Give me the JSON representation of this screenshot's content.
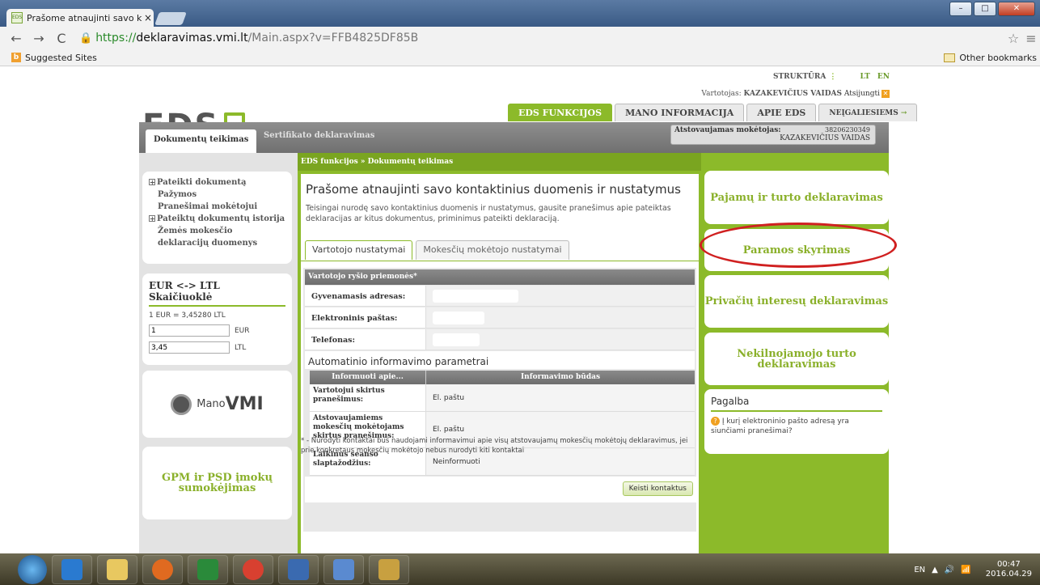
{
  "browser": {
    "tab_title": "Prašome atnaujinti savo k",
    "tab_close": "×",
    "url_https": "https://",
    "url_host": "deklaravimas.vmi.lt",
    "url_path": "/Main.aspx?v=FFB4825DF85B",
    "bookmark_suggested": "Suggested Sites",
    "bookmark_other": "Other bookmarks"
  },
  "header": {
    "logo_text": "EDS",
    "struktura": "STRUKTŪRA",
    "lang_lt": "LT",
    "lang_en": "EN",
    "user_label": "Vartotojas:",
    "user_name": "KAZAKEVIČIUS VAIDAS",
    "logout": "Atsijungti",
    "tabs": [
      "EDS FUNKCIJOS",
      "MANO INFORMACIJA",
      "APIE EDS",
      "NEĮGALIESIEMS"
    ]
  },
  "subnav": {
    "tab_active": "Dokumentų teikimas",
    "tab_other": "Sertifikato deklaravimas",
    "payer_label": "Atstovaujamas mokėtojas:",
    "payer_code": "38206230349",
    "payer_name": "KAZAKEVIČIUS VAIDAS"
  },
  "sidebar": {
    "items": [
      "Pateikti dokumentą",
      "Pažymos",
      "Pranešimai mokėtojui",
      "Pateiktų dokumentų istorija",
      "Žemės mokesčio deklaracijų duomenys"
    ],
    "calc_title": "EUR <-> LTL Skaičiuoklė",
    "calc_rate": "1 EUR = 3,45280 LTL",
    "calc_eur_value": "1",
    "calc_eur": "EUR",
    "calc_ltl_value": "3,45",
    "calc_ltl": "LTL",
    "mano_prefix": "Mano",
    "mano_vmi": "VMI",
    "gpm": "GPM ir PSD įmokų sumokėjimas"
  },
  "main": {
    "breadcrumb": "EDS funkcijos » Dokumentų teikimas",
    "title": "Prašome atnaujinti savo kontaktinius duomenis ir nustatymus",
    "desc": "Teisingai nurodę savo kontaktinius duomenis ir nustatymus, gausite pranešimus apie pateiktas deklaracijas ar kitus dokumentus, priminimus pateikti deklaraciją.",
    "tab1": "Vartotojo nustatymai",
    "tab2": "Mokesčių mokėtojo nustatymai",
    "contact_section": "Vartotojo ryšio priemonės*",
    "address_label": "Gyvenamasis adresas:",
    "email_label": "Elektroninis paštas:",
    "phone_label": "Telefonas:",
    "auto_title": "Automatinio informavimo parametrai",
    "col_inform": "Informuoti apie...",
    "col_method": "Informavimo būdas",
    "rows": [
      {
        "k": "Vartotojui skirtus pranešimus:",
        "v": "El. paštu"
      },
      {
        "k": "Atstovaujamiems mokesčių mokėtojams skirtus pranešimus:",
        "v": "El. paštu"
      },
      {
        "k": "Laikinus seanso slaptažodžius:",
        "v": "Neinformuoti"
      }
    ],
    "change_btn": "Keisti kontaktus",
    "footnote": "* - Nurodyti kontaktai bus naudojami informavimui apie visų atstovaujamų mokesčių mokėtojų deklaravimus, jei prie konkretaus mokesčių mokėtojo nebus nurodyti kiti kontaktai"
  },
  "right": {
    "box1": "Pajamų ir turto deklaravimas",
    "box2": "Paramos skyrimas",
    "box3": "Privačių interesų deklaravimas",
    "box4": "Nekilnojamojo turto deklaravimas",
    "help_title": "Pagalba",
    "help_q": "Į kurį elektroninio pašto adresą yra siunčiami pranešimai?"
  },
  "taskbar": {
    "lang": "EN",
    "time": "00:47",
    "date": "2016.04.29"
  },
  "colors": {
    "accent": "#8cba2a",
    "highlight_oval": "#d02020"
  }
}
